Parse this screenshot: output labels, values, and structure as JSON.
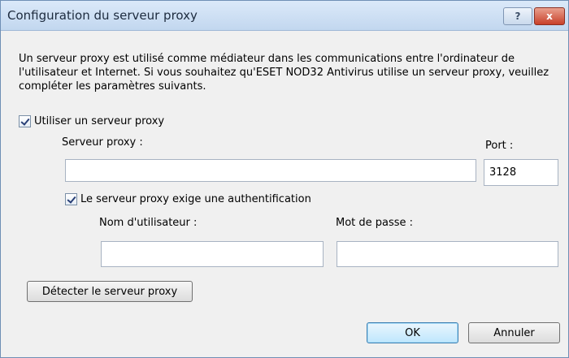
{
  "window": {
    "title": "Configuration du serveur proxy",
    "help_button": "?",
    "close_button": "x"
  },
  "description": "Un serveur proxy est utilisé comme médiateur dans les communications entre l'ordinateur de l'utilisateur et Internet. Si vous souhaitez qu'ESET NOD32 Antivirus utilise un serveur proxy, veuillez compléter les paramètres suivants.",
  "use_proxy": {
    "label": "Utiliser un serveur proxy",
    "checked": true
  },
  "proxy_server": {
    "label": "Serveur proxy :",
    "value": ""
  },
  "port": {
    "label": "Port :",
    "value": "3128"
  },
  "auth_required": {
    "label": "Le serveur proxy exige une authentification",
    "checked": true
  },
  "username": {
    "label": "Nom d'utilisateur :",
    "value": ""
  },
  "password": {
    "label": "Mot de passe :",
    "value": ""
  },
  "buttons": {
    "detect": "Détecter le serveur proxy",
    "ok": "OK",
    "cancel": "Annuler"
  }
}
